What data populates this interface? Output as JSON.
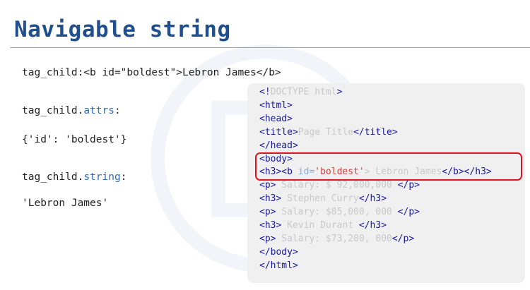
{
  "title": "Navigable string",
  "left": {
    "tag_child_line": "tag_child:<b id=\"boldest\">Lebron James</b>",
    "attrs_prefix": "tag_child.",
    "attrs_keyword": "attrs",
    "attrs_suffix": ":",
    "attrs_value": "{'id': 'boldest'}",
    "string_prefix": "tag_child.",
    "string_keyword": "string",
    "string_suffix": ":",
    "string_value": "'Lebron James'"
  },
  "code": {
    "l1a": "<!",
    "l1b": "DOCTYPE html",
    "l1c": ">",
    "l2": "<html>",
    "l3": "<head>",
    "l4a": "<title>",
    "l4b": "Page Title",
    "l4c": "</title>",
    "l5": "</head>",
    "l6": "<body>",
    "l7a": "<h3><b ",
    "l7b": "id=",
    "l7c": "'boldest'",
    "l7d": "> Lebron James",
    "l7e": "</b></h3>",
    "l8a": "<p>",
    "l8b": " Salary: $ 92,000,000 ",
    "l8c": "</p>",
    "l9a": "<h3>",
    "l9b": " Stephen Curry",
    "l9c": "</h3>",
    "l10a": "<p>",
    "l10b": " Salary: $85,000, 000 ",
    "l10c": "</p>",
    "l11a": "<h3>",
    "l11b": " Kevin Durant ",
    "l11c": "</h3>",
    "l12a": "<p>",
    "l12b": " Salary: $73,200, 000",
    "l12c": "</p>",
    "l13": "</body>",
    "l14": "</html>"
  },
  "colors": {
    "title": "#1f4f8f",
    "keyword": "#2f6fb3",
    "tag": "#1a1a9e",
    "highlight": "#e0141f"
  }
}
